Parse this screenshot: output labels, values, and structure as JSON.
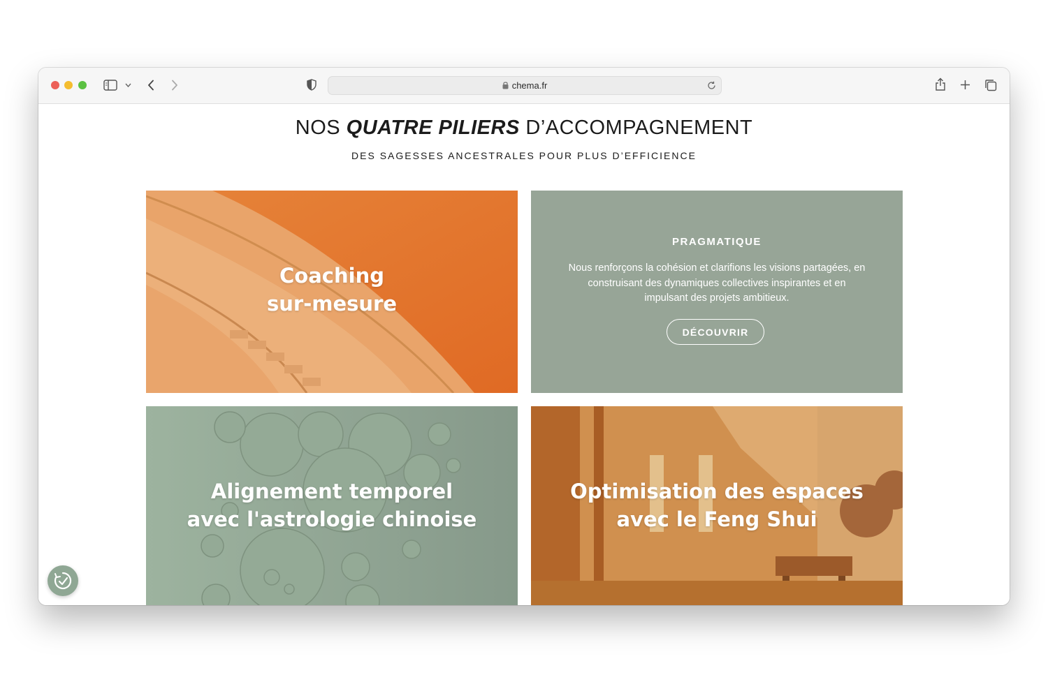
{
  "browser": {
    "url": "chema.fr",
    "icons": [
      "sidebar-icon",
      "chevron-down-icon",
      "back-icon",
      "forward-icon",
      "shield-icon",
      "lock-icon",
      "reload-icon",
      "share-icon",
      "new-tab-icon",
      "tabs-overview-icon"
    ]
  },
  "section": {
    "heading_before": "NOS",
    "heading_emphasis": "QUATRE PILIERS",
    "heading_after": "D’ACCOMPAGNEMENT",
    "subheading": "DES SAGESSES ANCESTRALES POUR PLUS D’EFFICIENCE"
  },
  "cards": {
    "coaching": {
      "line1": "Coaching",
      "line2": "sur-mesure",
      "color": "#e07a32"
    },
    "pragmatique": {
      "title": "PRAGMATIQUE",
      "text_lines": [
        "Nous renforçons la cohésion et clarifions les visions partagées, en",
        "construisant des dynamiques collectives inspirantes et en",
        "impulsant des projets ambitieux."
      ],
      "button": "DÉCOUVRIR",
      "color": "#97a597"
    },
    "alignement": {
      "line1": "Alignement temporel",
      "line2": "avec l'astrologie chinoise",
      "color": "#8fa390"
    },
    "optimisation": {
      "line1": "Optimisation des espaces",
      "line2": "avec le Feng Shui",
      "color": "#c97a3a"
    }
  },
  "widget": {
    "icon": "accessibility-check-icon",
    "color": "#8fa794"
  }
}
